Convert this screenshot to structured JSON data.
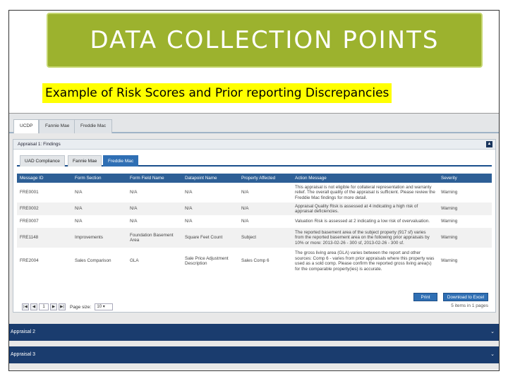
{
  "slide": {
    "title": "DATA COLLECTION POINTS",
    "subtitle": "Example of Risk Scores and Prior reporting Discrepancies"
  },
  "app": {
    "top_tabs": [
      {
        "label": "UCDP",
        "active": true
      },
      {
        "label": "Fannie Mae",
        "active": false
      },
      {
        "label": "Freddie Mac",
        "active": false
      }
    ],
    "findings_panel": {
      "title": "Appraisal 1: Findings",
      "collapse_icon": "caret-up-icon",
      "sub_tabs": [
        {
          "label": "UAD Compliance",
          "active": false
        },
        {
          "label": "Fannie Mae",
          "active": false
        },
        {
          "label": "Freddie Mac",
          "active": true
        }
      ],
      "columns": [
        "Message ID",
        "Form Section",
        "Form Field Name",
        "Datapoint Name",
        "Property Affected",
        "Action Message",
        "Severity"
      ],
      "rows": [
        {
          "id": "FRE0001",
          "section": "N/A",
          "field": "N/A",
          "datapoint": "N/A",
          "property": "N/A",
          "message": "This appraisal is not eligible for collateral representation and warranty relief. The overall quality of the appraisal is sufficient. Please review the Freddie Mac findings for more detail.",
          "severity": "Warning"
        },
        {
          "id": "FRE0002",
          "section": "N/A",
          "field": "N/A",
          "datapoint": "N/A",
          "property": "N/A",
          "message": "Appraisal Quality Risk is assessed at 4 indicating a high risk of appraisal deficiencies.",
          "severity": "Warning"
        },
        {
          "id": "FRE0007",
          "section": "N/A",
          "field": "N/A",
          "datapoint": "N/A",
          "property": "N/A",
          "message": "Valuation Risk is assessed at 2 indicating a low risk of overvaluation.",
          "severity": "Warning"
        },
        {
          "id": "FRE1148",
          "section": "Improvements",
          "field": "Foundation Basement Area",
          "datapoint": "Square Feet Count",
          "property": "Subject",
          "message": "The reported basement area of the subject property (917 sf) varies from the reported basement area on the following prior appraisals by 10% or more: 2013-02-26 - 300 sf, 2013-02-26 - 300 sf.",
          "severity": "Warning"
        },
        {
          "id": "FRE2004",
          "section": "Sales Comparison",
          "field": "GLA",
          "datapoint": "Sale Price Adjustment Description",
          "property": "Sales Comp 6",
          "message": "The gross living area (GLA) varies between the report and other sources: Comp 6 - varies from prior appraisals where this property was used as a sold comp. Please confirm the reported gross living area(s) for the comparable property(ies) is accurate.",
          "severity": "Warning"
        }
      ],
      "pager": {
        "first_icon": "first-page-icon",
        "prev_icon": "prev-page-icon",
        "page": "1",
        "next_icon": "next-page-icon",
        "last_icon": "last-page-icon",
        "page_size_label": "Page size:",
        "page_size": "10",
        "items_info": "5 items in 1 pages"
      },
      "buttons": {
        "print": "Print",
        "download": "Download to Excel"
      }
    },
    "accordions": [
      {
        "label": "Appraisal 2",
        "icon": "chevron-down-icon"
      },
      {
        "label": "Appraisal 3",
        "icon": "chevron-down-icon"
      }
    ]
  },
  "colors": {
    "title_banner": "#9cb22e",
    "subtitle_highlight": "#ffff00",
    "grid_header": "#2d5f96",
    "active_tab": "#2f6fb4",
    "accordion": "#1a3c6e"
  }
}
